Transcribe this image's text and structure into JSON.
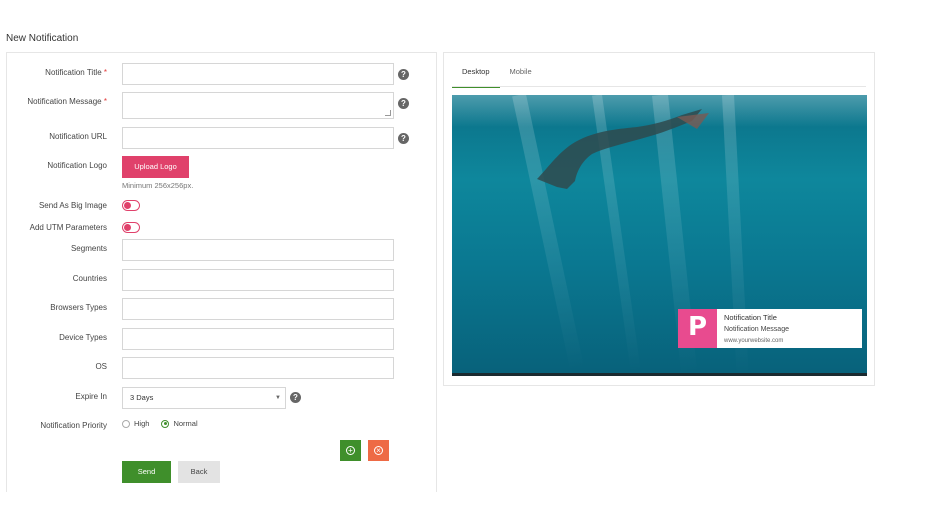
{
  "page": {
    "title": "New Notification"
  },
  "form": {
    "title_label": "Notification Title",
    "message_label": "Notification Message",
    "url_label": "Notification URL",
    "logo_label": "Notification Logo",
    "upload_button": "Upload Logo",
    "logo_hint": "Minimum 256x256px.",
    "big_image_label": "Send As Big Image",
    "utm_label": "Add UTM Parameters",
    "segments_label": "Segments",
    "countries_label": "Countries",
    "browsers_label": "Browsers Types",
    "devices_label": "Device Types",
    "os_label": "OS",
    "expire_label": "Expire In",
    "expire_value": "3 Days",
    "priority_label": "Notification Priority",
    "priority_options": [
      "High",
      "Normal"
    ],
    "priority_selected": "Normal",
    "required_mark": "*",
    "help_glyph": "?",
    "send_button": "Send",
    "back_button": "Back"
  },
  "preview": {
    "tabs": [
      "Desktop",
      "Mobile"
    ],
    "active_tab": "Desktop",
    "notification": {
      "title": "Notification Title",
      "message": "Notification Message",
      "url": "www.yourwebsite.com",
      "logo_letter": "P"
    }
  },
  "colors": {
    "brand_pink": "#e0416b",
    "primary_green": "#3f8f2b",
    "remove_orange": "#ee6a45",
    "logo_pink": "#e84b8f"
  },
  "icons": {
    "add": "plus-circle-icon",
    "remove": "x-circle-icon",
    "help": "question-icon",
    "select": "caret-down-icon"
  }
}
